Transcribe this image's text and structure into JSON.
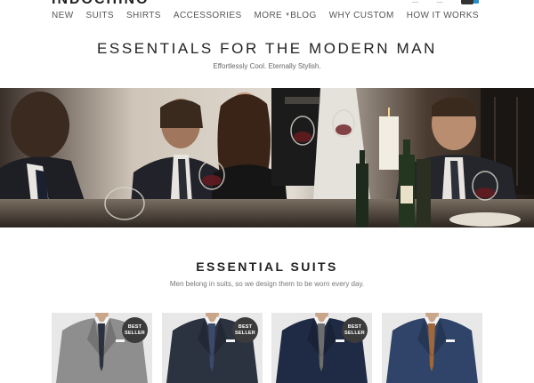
{
  "brand": {
    "logo_text": "INDOCHINO"
  },
  "nav": {
    "left": [
      {
        "label": "NEW"
      },
      {
        "label": "SUITS"
      },
      {
        "label": "SHIRTS"
      },
      {
        "label": "ACCESSORIES"
      },
      {
        "label": "MORE",
        "has_caret": true
      }
    ],
    "right": [
      {
        "label": "BLOG"
      },
      {
        "label": "WHY CUSTOM"
      },
      {
        "label": "HOW IT WORKS"
      }
    ]
  },
  "hero": {
    "title": "ESSENTIALS FOR THE MODERN MAN",
    "subtitle": "Effortlessly Cool. Eternally Stylish."
  },
  "section": {
    "title": "ESSENTIAL SUITS",
    "subtitle": "Men belong in suits, so we design them to be worn every day."
  },
  "badge": {
    "line1": "BEST",
    "line2": "SELLER"
  },
  "suits": [
    {
      "color": "#8e8e8e",
      "tie": "#2c3140",
      "best_seller": true
    },
    {
      "color": "#2b3240",
      "tie": "#3a4a6a",
      "best_seller": true
    },
    {
      "color": "#1f2a44",
      "tie": "#6d6d6d",
      "best_seller": true
    },
    {
      "color": "#2f4468",
      "tie": "#a0683a",
      "best_seller": false
    }
  ],
  "colors": {
    "accent": "#2a8cc9",
    "text": "#222222",
    "muted": "#777777"
  }
}
